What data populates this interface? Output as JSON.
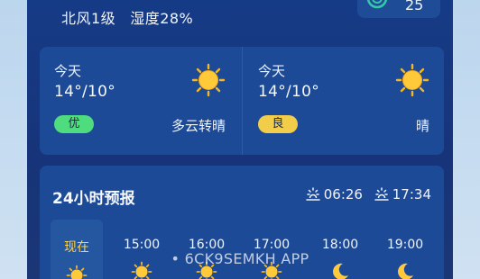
{
  "current": {
    "wind": "北风1级",
    "humidity": "湿度28%"
  },
  "aqi": {
    "value": "25"
  },
  "days": [
    {
      "name": "今天",
      "temp": "14°/10°",
      "badge": "优",
      "desc": "多云转晴"
    },
    {
      "name": "今天",
      "temp": "14°/10°",
      "badge": "良",
      "desc": "晴"
    }
  ],
  "hourly": {
    "title": "24小时预报",
    "sunrise": "06:26",
    "sunset": "17:34",
    "items": [
      {
        "time": "现在",
        "icon": "sun-icon"
      },
      {
        "time": "15:00",
        "icon": "sun-icon"
      },
      {
        "time": "16:00",
        "icon": "sun-icon"
      },
      {
        "time": "17:00",
        "icon": "sun-icon"
      },
      {
        "time": "18:00",
        "icon": "moon-icon"
      },
      {
        "time": "19:00",
        "icon": "moon-icon"
      }
    ]
  },
  "watermark": "• 6CK9SEMKH APP",
  "colors": {
    "sun": "#f6b71f",
    "sun_light": "#ffd447",
    "good": "#4fdc7e",
    "fair": "#f2cd4a",
    "now_label": "#ffd24d"
  }
}
